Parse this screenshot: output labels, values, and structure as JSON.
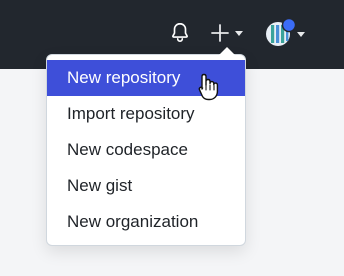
{
  "header": {
    "icons": {
      "notifications": "bell-icon",
      "create_new": "plus-icon",
      "create_new_caret": "chevron-down-icon",
      "profile": "avatar-icon",
      "profile_caret": "chevron-down-icon"
    },
    "avatar_status_color": "#3b6cf6"
  },
  "create_menu": {
    "items": [
      {
        "label": "New repository",
        "active": true
      },
      {
        "label": "Import repository"
      },
      {
        "label": "New codespace"
      },
      {
        "label": "New gist"
      },
      {
        "label": "New organization"
      }
    ]
  },
  "colors": {
    "topbar_bg": "#22272e",
    "active_item_bg": "#3e4fd9",
    "page_bg": "#f4f5f7"
  }
}
